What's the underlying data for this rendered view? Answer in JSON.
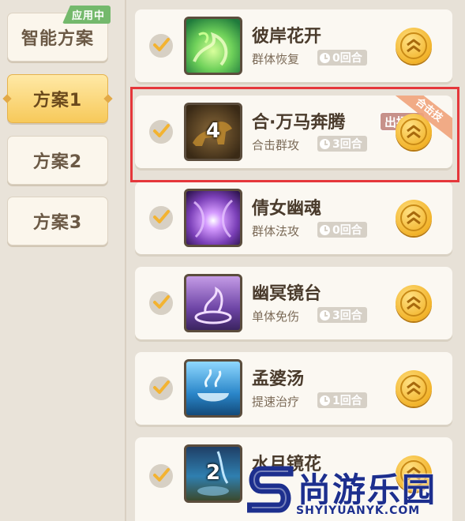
{
  "sidebar": {
    "plans": [
      {
        "label": "智能方案",
        "tag": "应用中"
      },
      {
        "label": "方案1"
      },
      {
        "label": "方案2"
      },
      {
        "label": "方案3"
      }
    ]
  },
  "skills": [
    {
      "name": "彼岸花开",
      "type": "群体恢复",
      "cooldown": "0回合"
    },
    {
      "name": "合·万马奔腾",
      "type": "合击群攻",
      "cooldown": "3回合",
      "icon_number": "4",
      "status": "出招中",
      "ribbon": "合击技"
    },
    {
      "name": "倩女幽魂",
      "type": "群体法攻",
      "cooldown": "0回合"
    },
    {
      "name": "幽冥镜台",
      "type": "单体免伤",
      "cooldown": "3回合"
    },
    {
      "name": "孟婆汤",
      "type": "提速治疗",
      "cooldown": "1回合"
    },
    {
      "name": "水月镜花",
      "icon_number": "2"
    }
  ],
  "watermark": {
    "brand": "尚游乐园",
    "url": "SHYIYUANYK.COM"
  },
  "colors": {
    "active_plan": "#f7c95a",
    "applied_tag": "#74b96c",
    "highlight": "#e5373b",
    "coin": "#f2b32a"
  }
}
